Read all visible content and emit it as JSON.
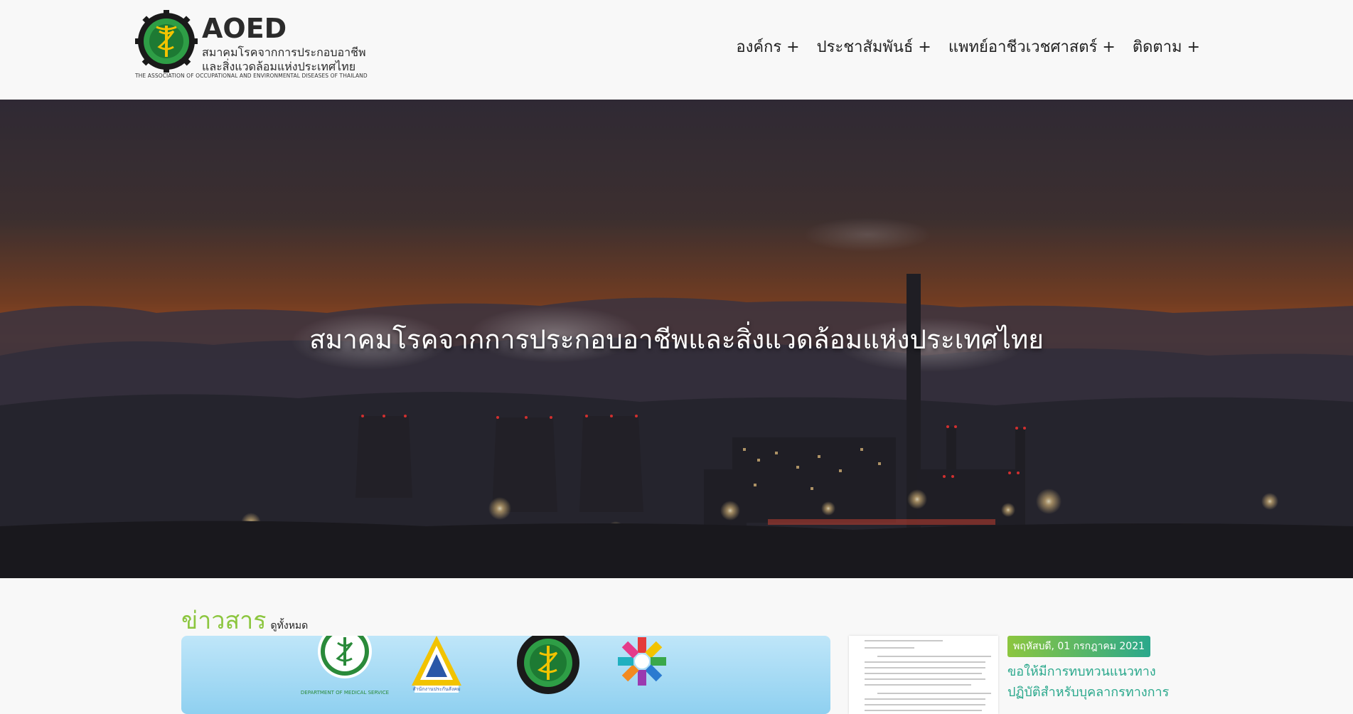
{
  "site": {
    "logo_title": "AOED",
    "logo_line1": "สมาคมโรคจากการประกอบอาชีพ",
    "logo_line2": "และสิ่งแวดล้อมแห่งประเทศไทย",
    "logo_english": "THE ASSOCIATION OF OCCUPATIONAL AND ENVIRONMENTAL DISEASES OF THAILAND"
  },
  "nav": {
    "items": [
      {
        "label": "องค์กร +"
      },
      {
        "label": "ประชาสัมพันธ์ +"
      },
      {
        "label": "แพทย์อาชีวเวชศาสตร์ +"
      },
      {
        "label": "ติดตาม +"
      }
    ]
  },
  "hero": {
    "title": "สมาคมโรคจากการประกอบอาชีพและสิ่งแวดล้อมแห่งประเทศไทย"
  },
  "news": {
    "heading": "ข่าวสาร",
    "view_all": "ดูทั้งหมด",
    "partner_labels": [
      "DEPARTMENT OF MEDICAL SERVICE",
      "สำนักงานประกันสังคม"
    ],
    "item": {
      "date": "พฤหัสบดี, 01 กรกฎาคม 2021",
      "headline": "ขอให้มีการทบทวนแนวทางปฏิบัติสำหรับบุคลากรทางการ"
    }
  },
  "colors": {
    "accent_green": "#8cc63f",
    "accent_teal": "#2aa88c"
  }
}
